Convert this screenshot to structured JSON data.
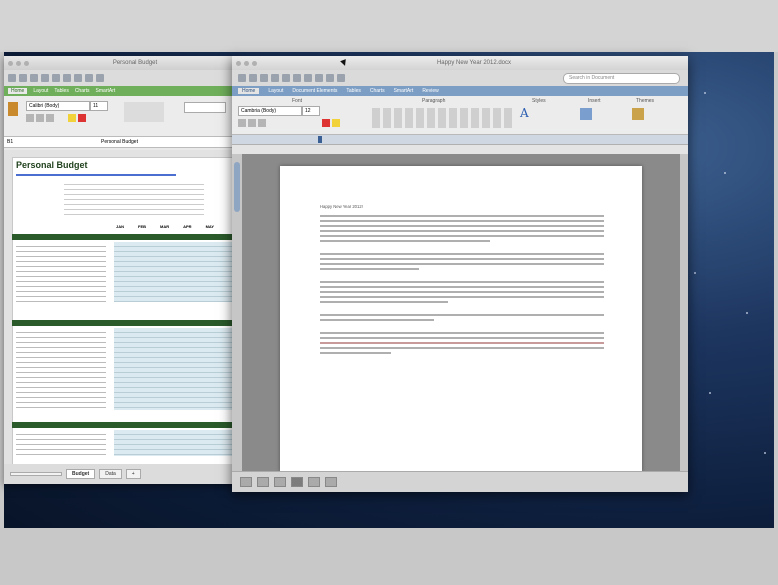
{
  "excel": {
    "window_title": "Personal Budget",
    "ribbon_tabs": [
      "Home",
      "Layout",
      "Tables",
      "Charts",
      "SmartArt"
    ],
    "font_name": "Calibri (Body)",
    "font_size": "11",
    "name_box": "B1",
    "formula_value": "Personal Budget",
    "sheet_title": "Personal Budget",
    "sheet_tabs": [
      "Budget",
      "Data"
    ],
    "active_sheet": "Budget",
    "month_headers": [
      "JAN",
      "FEB",
      "MAR",
      "APR",
      "MAY"
    ]
  },
  "word": {
    "window_title": "Happy New Year 2012.docx",
    "search_placeholder": "Search in Document",
    "ribbon_tabs": [
      "Home",
      "Layout",
      "Document Elements",
      "Tables",
      "Charts",
      "SmartArt",
      "Review"
    ],
    "active_tab": "Home",
    "groups": [
      "Font",
      "Paragraph",
      "Styles",
      "Insert",
      "Themes"
    ],
    "font_name": "Cambria (Body)",
    "font_size": "12",
    "doc_heading": "Happy New Year 2012!"
  }
}
